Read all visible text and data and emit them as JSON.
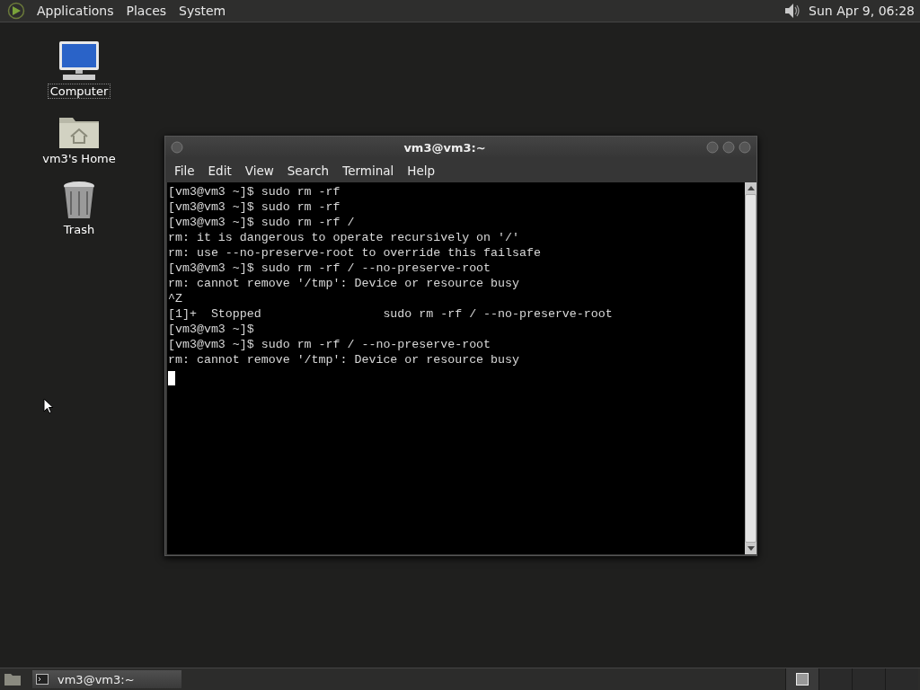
{
  "top_panel": {
    "menus": [
      "Applications",
      "Places",
      "System"
    ],
    "clock": "Sun Apr  9, 06:28"
  },
  "desktop_icons": [
    {
      "kind": "computer",
      "label": "Computer",
      "selected": true
    },
    {
      "kind": "home",
      "label": "vm3's Home",
      "selected": false
    },
    {
      "kind": "trash",
      "label": "Trash",
      "selected": false
    }
  ],
  "window": {
    "title": "vm3@vm3:~",
    "menu": [
      "File",
      "Edit",
      "View",
      "Search",
      "Terminal",
      "Help"
    ],
    "terminal_lines": [
      "[vm3@vm3 ~]$ sudo rm -rf",
      "[vm3@vm3 ~]$ sudo rm -rf",
      "[vm3@vm3 ~]$ sudo rm -rf /",
      "rm: it is dangerous to operate recursively on '/'",
      "rm: use --no-preserve-root to override this failsafe",
      "[vm3@vm3 ~]$ sudo rm -rf / --no-preserve-root",
      "rm: cannot remove '/tmp': Device or resource busy",
      "^Z",
      "[1]+  Stopped                 sudo rm -rf / --no-preserve-root",
      "[vm3@vm3 ~]$",
      "[vm3@vm3 ~]$ sudo rm -rf / --no-preserve-root",
      "rm: cannot remove '/tmp': Device or resource busy"
    ]
  },
  "taskbar": {
    "tasks": [
      {
        "label": "vm3@vm3:~",
        "selected": true
      }
    ],
    "workspaces": [
      {
        "selected": true
      },
      {
        "selected": false
      },
      {
        "selected": false
      },
      {
        "selected": false
      }
    ]
  }
}
